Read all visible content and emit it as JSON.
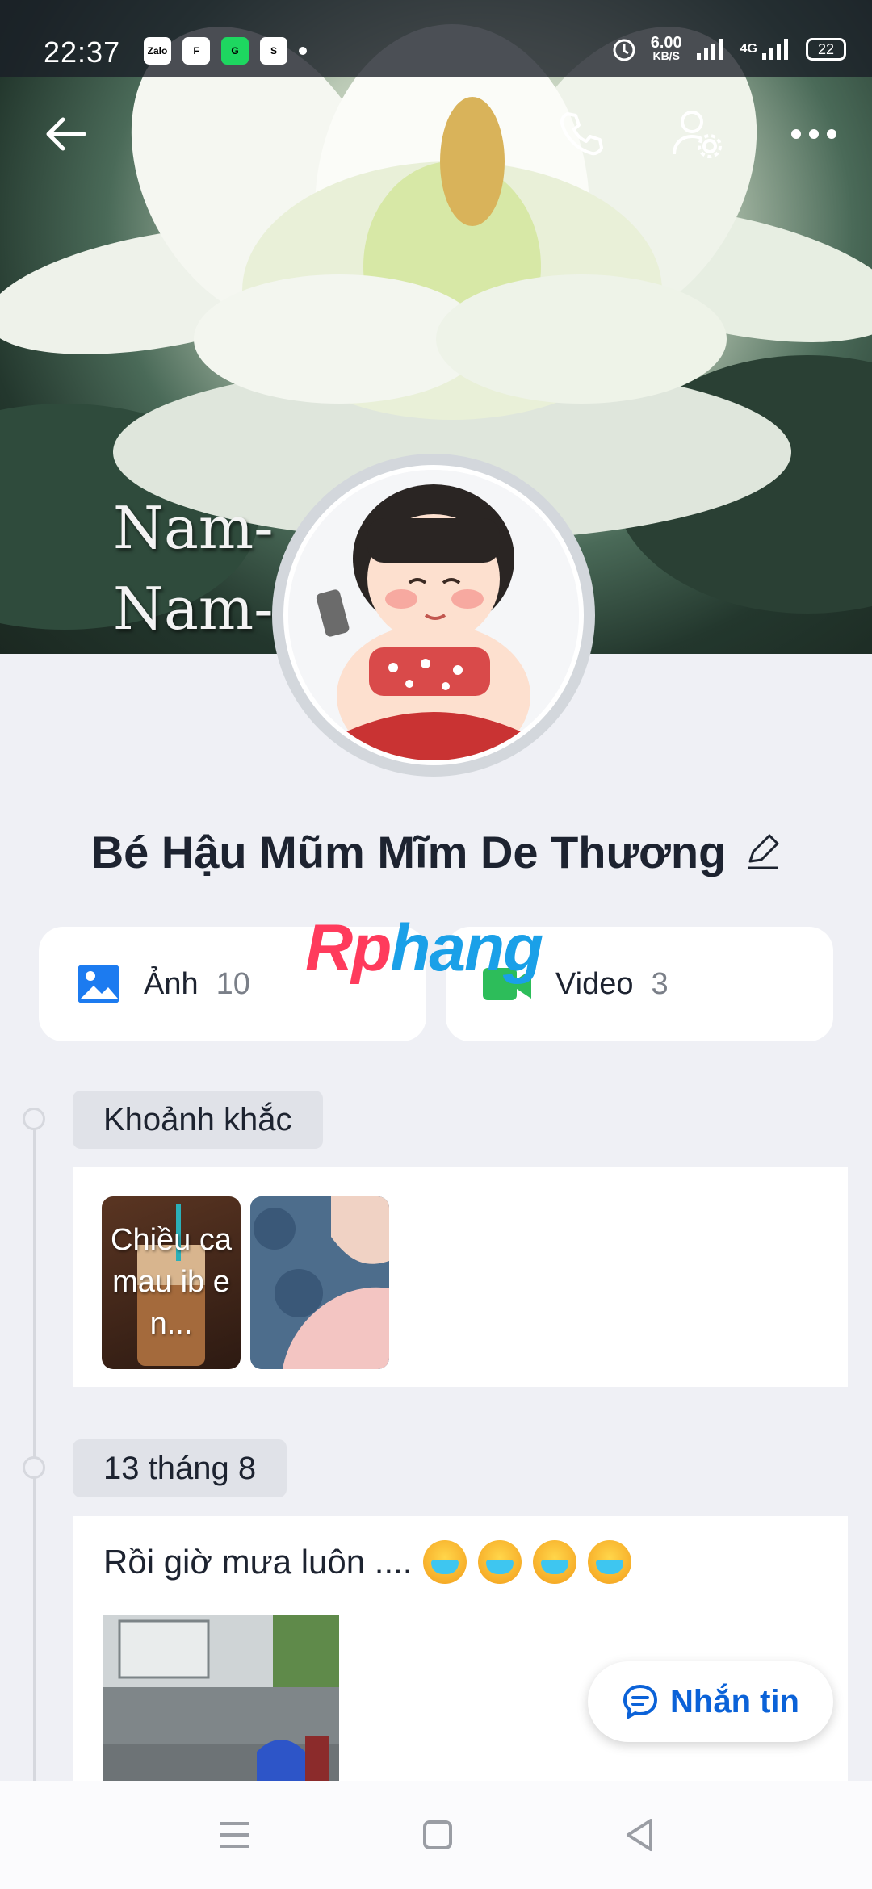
{
  "status_bar": {
    "time": "22:37",
    "apps": [
      "Zalo",
      "F",
      "G",
      "S"
    ],
    "speed_value": "6.00",
    "speed_unit": "KB/S",
    "network": "4G",
    "battery": "22"
  },
  "cover": {
    "line1": "Nam-   đà Phật",
    "line2": "Nam-    à Phật"
  },
  "top_actions": [
    "back-arrow-icon",
    "phone-icon",
    "profile-settings-icon",
    "more-icon"
  ],
  "profile": {
    "name": "Bé Hậu Mũm Mĩm De Thương"
  },
  "watermark": {
    "part1": "Rp",
    "part2": "hang"
  },
  "media": {
    "photos": {
      "label": "Ảnh",
      "count": "10"
    },
    "videos": {
      "label": "Video",
      "count": "3"
    }
  },
  "moments": {
    "title": "Khoảnh khắc",
    "first_text": "Chiều ca mau ib e n..."
  },
  "post": {
    "date": "13 tháng 8",
    "text": "Rồi giờ mưa luôn ...."
  },
  "fab": {
    "label": "Nhắn tin"
  },
  "colors": {
    "accent": "#0b62d8",
    "background": "#eff0f5",
    "video_green": "#2dbd5a",
    "photo_blue": "#1c7bf0"
  }
}
